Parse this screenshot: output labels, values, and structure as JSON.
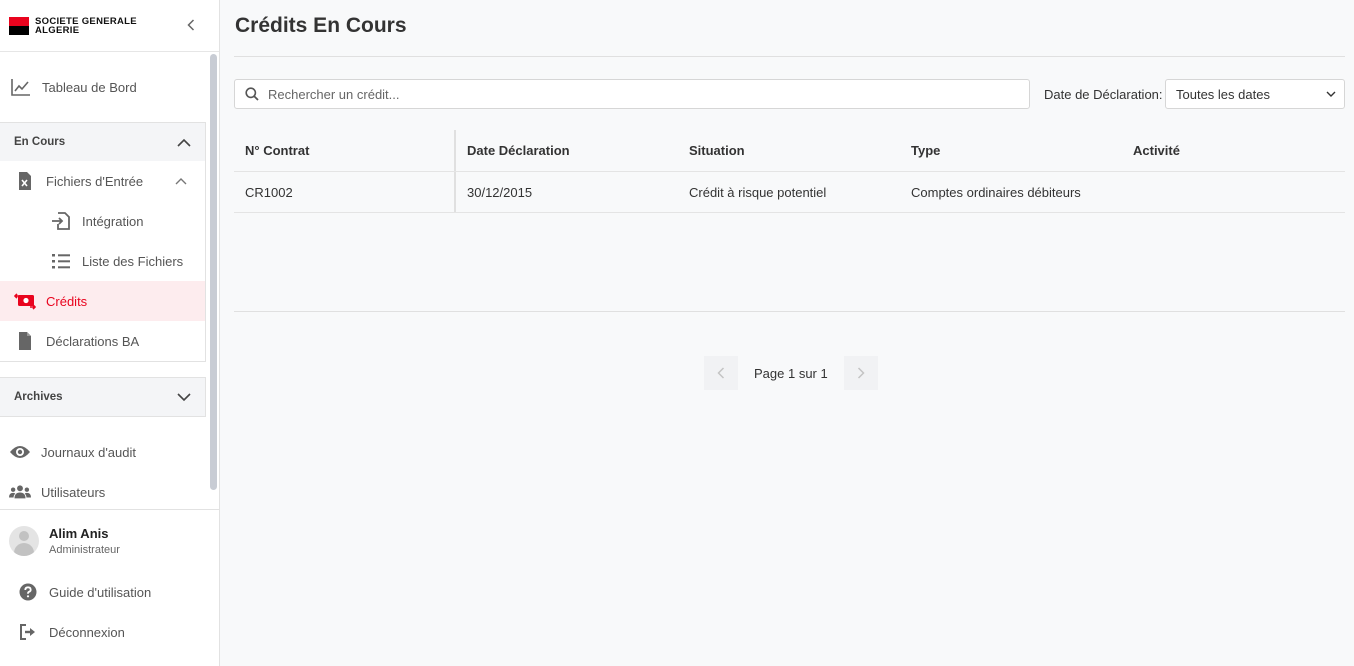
{
  "brand": {
    "line1": "SOCIETE GENERALE",
    "line2": "ALGERIE",
    "colors": {
      "red": "#e9041e",
      "black": "#000000"
    }
  },
  "nav": {
    "dashboard": "Tableau de Bord",
    "en_cours": {
      "title": "En Cours",
      "fichiers": "Fichiers d'Entrée",
      "integration": "Intégration",
      "liste": "Liste des Fichiers",
      "credits": "Crédits",
      "declarations": "Déclarations BA"
    },
    "archives": "Archives",
    "journaux": "Journaux d'audit",
    "utilisateurs": "Utilisateurs"
  },
  "user": {
    "name": "Alim Anis",
    "role": "Administrateur"
  },
  "footer": {
    "guide": "Guide d'utilisation",
    "logout": "Déconnexion"
  },
  "page": {
    "title": "Crédits En Cours"
  },
  "search": {
    "placeholder": "Rechercher un crédit..."
  },
  "filter": {
    "label": "Date de Déclaration:",
    "selected": "Toutes les dates"
  },
  "table": {
    "headers": [
      "N° Contrat",
      "Date Déclaration",
      "Situation",
      "Type",
      "Activité"
    ],
    "rows": [
      [
        "CR1002",
        "30/12/2015",
        "Crédit à risque potentiel",
        "Comptes ordinaires débiteurs",
        ""
      ]
    ]
  },
  "pagination": {
    "text": "Page 1 sur 1"
  },
  "accent_color": "#e9041e"
}
